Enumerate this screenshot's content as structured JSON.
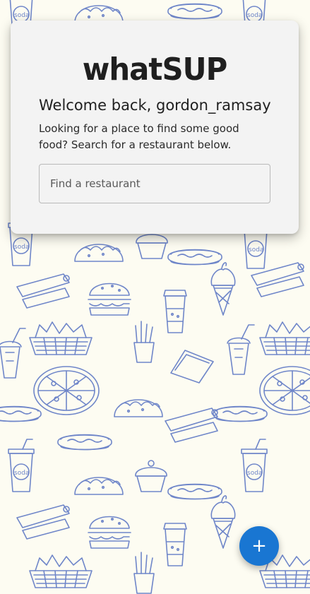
{
  "app": {
    "logo_text": "whatSUP"
  },
  "welcome": {
    "prefix": "Welcome back, ",
    "username": "gordon_ramsay"
  },
  "intro": {
    "text": "Looking for a place to find some good food? Search for a restaurant below."
  },
  "search": {
    "placeholder": "Find a restaurant",
    "value": ""
  },
  "fab": {
    "icon": "plus-icon",
    "symbol": "+"
  },
  "background": {
    "pattern": "food-doodles",
    "cup_label": "soda"
  },
  "colors": {
    "accent": "#1976d2",
    "doodle": "#6f86c9",
    "background": "#fdfcf2",
    "card": "#f3f3f3"
  }
}
